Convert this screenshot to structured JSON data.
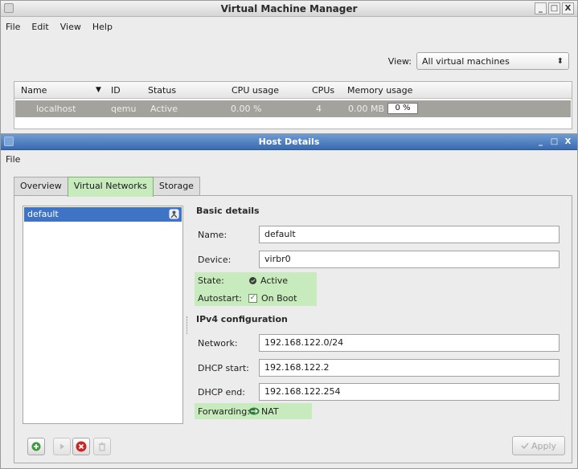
{
  "vmm": {
    "title": "Virtual Machine Manager",
    "window_buttons": {
      "minimize": "_",
      "maximize": "□",
      "close": "X"
    },
    "menu": [
      "File",
      "Edit",
      "View",
      "Help"
    ],
    "view_label": "View:",
    "view_value": "All virtual machines",
    "table": {
      "headers": {
        "name": "Name",
        "id": "ID",
        "status": "Status",
        "cpu_usage": "CPU usage",
        "cpus": "CPUs",
        "memory_usage": "Memory usage"
      },
      "rows": [
        {
          "name": "localhost",
          "id": "qemu",
          "status": "Active",
          "cpu_usage": "0.00 %",
          "cpus": "4",
          "memory_text": "0.00 MB",
          "memory_bar": "0 %"
        }
      ]
    }
  },
  "host": {
    "title": "Host Details",
    "window_buttons": {
      "minimize": "_",
      "maximize": "□",
      "close": "X"
    },
    "menu": [
      "File"
    ],
    "tabs": [
      "Overview",
      "Virtual Networks",
      "Storage"
    ],
    "active_tab": "Virtual Networks",
    "networks": [
      "default"
    ],
    "basic_details_title": "Basic details",
    "name_label": "Name:",
    "name_value": "default",
    "device_label": "Device:",
    "device_value": "virbr0",
    "state_label": "State:",
    "state_value": "Active",
    "autostart_label": "Autostart:",
    "autostart_value": "On Boot",
    "autostart_checked": true,
    "ipv4_title": "IPv4 configuration",
    "network_label": "Network:",
    "network_value": "192.168.122.0/24",
    "dhcp_start_label": "DHCP start:",
    "dhcp_start_value": "192.168.122.2",
    "dhcp_end_label": "DHCP end:",
    "dhcp_end_value": "192.168.122.254",
    "forwarding_label": "Forwarding:",
    "forwarding_value": "NAT",
    "apply_label": "Apply"
  },
  "colors": {
    "selection": "#3f73c3",
    "highlight": "#c7ebbd",
    "row_selected": "#a4a29c",
    "host_titlebar": "#3a6bb0"
  },
  "icons": [
    "app-icon",
    "network-icon",
    "add-network-icon",
    "start-network-icon",
    "stop-network-icon",
    "delete-network-icon",
    "state-icon",
    "nat-icon",
    "apply-icon"
  ]
}
